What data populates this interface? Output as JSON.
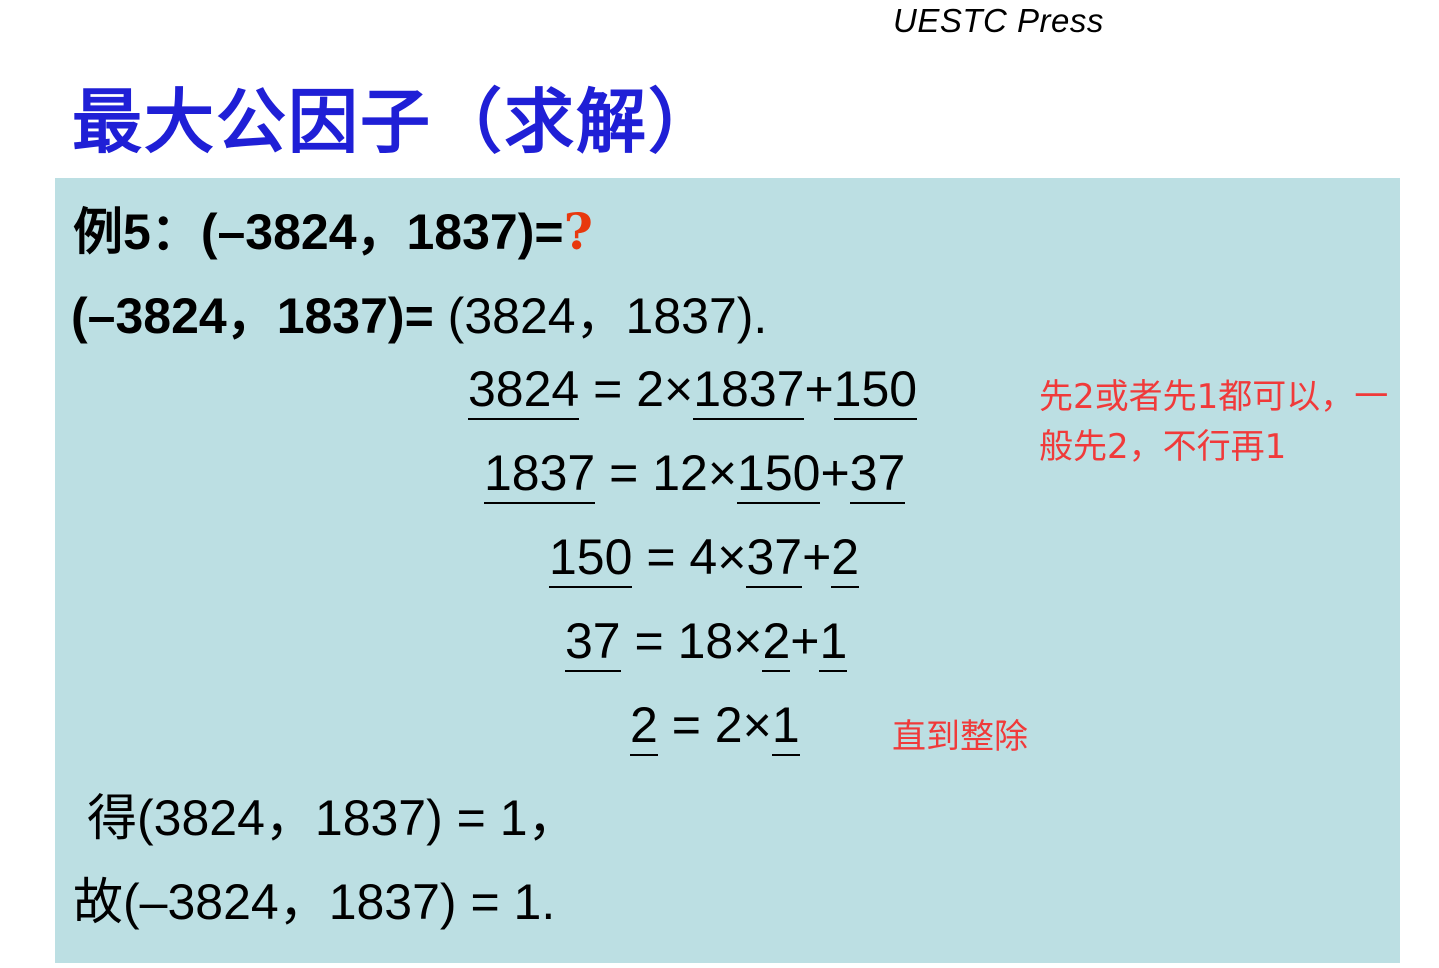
{
  "header": {
    "publisher": "UESTC Press"
  },
  "slide": {
    "title": "最大公因子（求解）",
    "example": {
      "label": "例5：",
      "expr": "(–3824，1837)=",
      "question": "?"
    },
    "restate": {
      "bold": "(–3824，1837)=",
      "plain": " (3824，1837)."
    },
    "steps": [
      {
        "lhs": "3824 ",
        "eq": " = ",
        "q": "2×",
        "div": "1837",
        "plus": "+",
        "rem": "150"
      },
      {
        "lhs": "1837",
        "eq": " = ",
        "q": "12×",
        "div": "150",
        "plus": "+",
        "rem": "37"
      },
      {
        "lhs": "150",
        "eq": " = ",
        "q": "4×",
        "div": "37",
        "plus": "+",
        "rem": "2"
      },
      {
        "lhs": "37",
        "eq": " = ",
        "q": "18×",
        "div": "2",
        "plus": "+",
        "rem": "1"
      },
      {
        "lhs": "2",
        "eq": " = ",
        "q": "2×",
        "div": "1"
      }
    ],
    "notes": {
      "order_line1": "先2或者先1都可以，一",
      "order_line2": "般先2，不行再1",
      "until": "直到整除"
    },
    "result1": "得(3824，1837) = 1，",
    "result2": "故(–3824，1837) = 1."
  },
  "colors": {
    "title": "#1f1fd6",
    "panel": "#bcdfe3",
    "note": "#f03a3a",
    "question": "#e8380d"
  }
}
